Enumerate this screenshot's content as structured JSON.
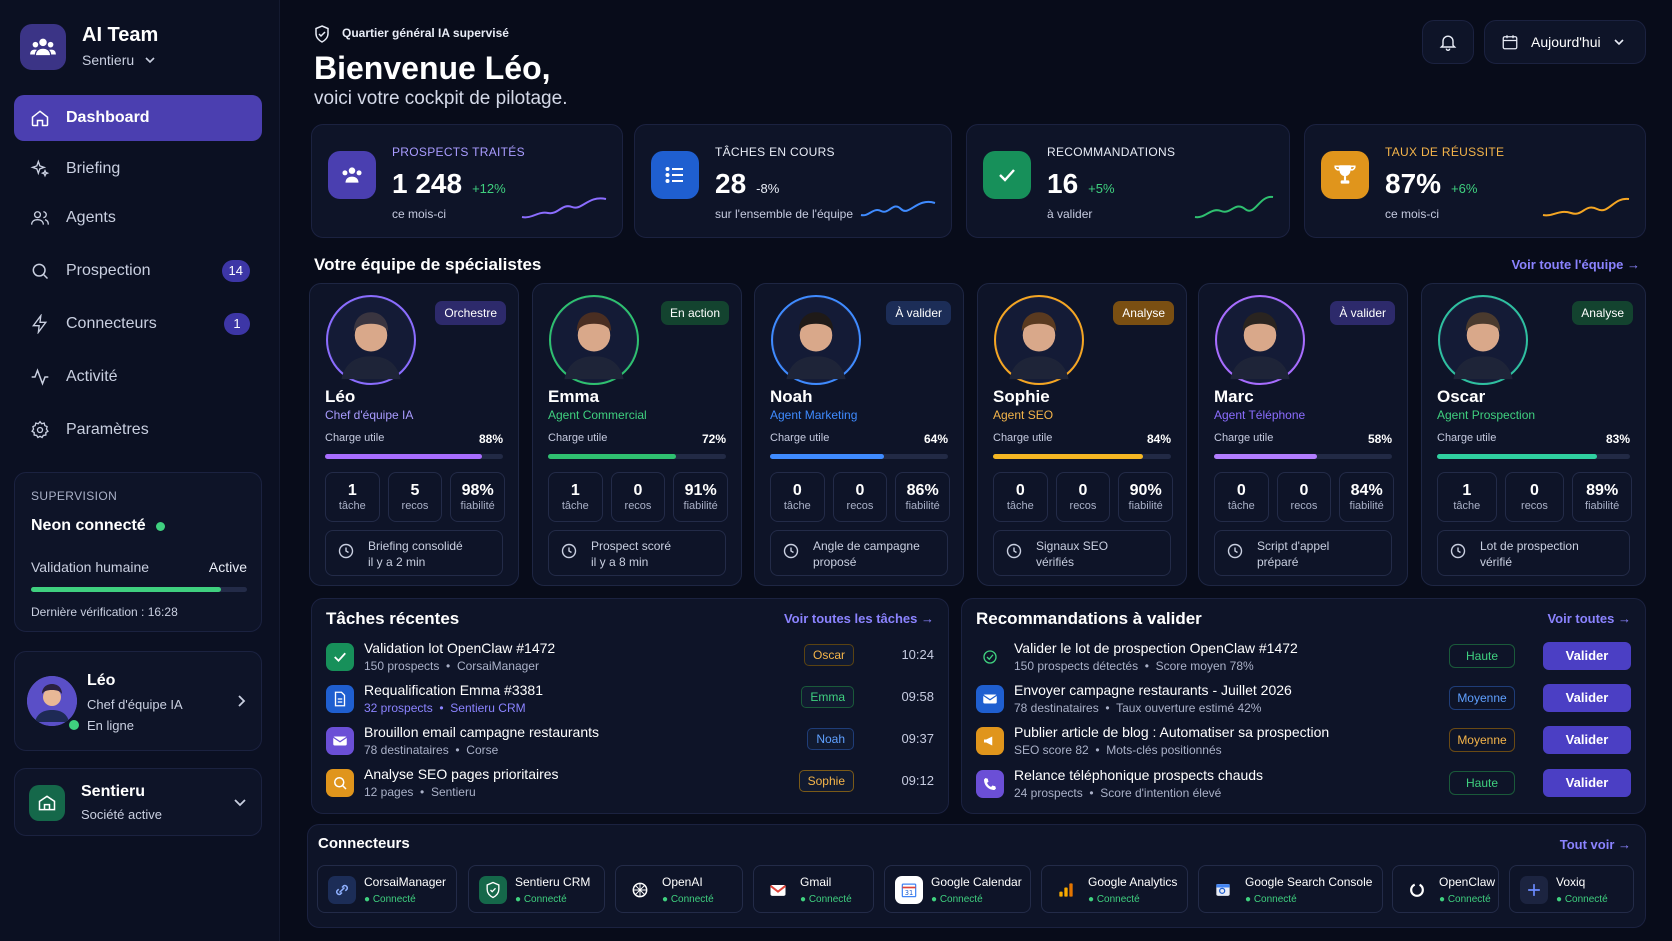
{
  "colors": {
    "accent": "#4b3fb0",
    "success": "#3fd07f",
    "warning": "#f5a623"
  },
  "sidebar": {
    "team_name": "AI Team",
    "org": "Sentieru",
    "nav": [
      {
        "label": "Dashboard",
        "icon": "home-icon"
      },
      {
        "label": "Briefing",
        "icon": "sparkle-icon"
      },
      {
        "label": "Agents",
        "icon": "users-icon"
      },
      {
        "label": "Prospection",
        "icon": "search-icon",
        "badge": "14"
      },
      {
        "label": "Connecteurs",
        "icon": "bolt-icon",
        "badge": "1"
      },
      {
        "label": "Activité",
        "icon": "activity-icon"
      },
      {
        "label": "Paramètres",
        "icon": "gear-icon"
      }
    ],
    "supervision": {
      "title": "SUPERVISION",
      "status": "Neon connecté",
      "validation_label": "Validation humaine",
      "validation_state": "Active",
      "progress": 0.88,
      "last_check": "Dernière vérification : 16:28"
    },
    "user": {
      "name": "Léo",
      "role": "Chef d'équipe IA",
      "status": "En ligne"
    },
    "company": {
      "name": "Sentieru",
      "sub": "Société active"
    }
  },
  "header": {
    "supervised": "Quartier général IA supervisé",
    "title": "Bienvenue Léo,",
    "subtitle": "voici votre cockpit de pilotage.",
    "date_button": "Aujourd'hui"
  },
  "stats": [
    {
      "label": "PROSPECTS TRAITÉS",
      "value": "1 248",
      "change": "+12%",
      "sub": "ce mois-ci"
    },
    {
      "label": "TÂCHES EN COURS",
      "value": "28",
      "change": "-8%",
      "sub": "sur l'ensemble de l'équipe"
    },
    {
      "label": "RECOMMANDATIONS",
      "value": "16",
      "change": "+5%",
      "sub": "à valider"
    },
    {
      "label": "TAUX DE RÉUSSITE",
      "value": "87%",
      "change": "+6%",
      "sub": "ce mois-ci"
    }
  ],
  "team": {
    "title": "Votre équipe de spécialistes",
    "link": "Voir toute l'équipe →",
    "load_label": "Charge utile",
    "tache_label": "tâche",
    "recos_label": "recos",
    "fiab_label": "fiabilité",
    "members": [
      {
        "name": "Léo",
        "role": "Chef d'équipe IA",
        "status": "Orchestre",
        "load": "88%",
        "load_value": 0.88,
        "taches": "1",
        "recos": "5",
        "fiabilite": "98%",
        "activity": "Briefing consolidé",
        "activity_time": "il y a 2 min"
      },
      {
        "name": "Emma",
        "role": "Agent Commercial",
        "status": "En action",
        "load": "72%",
        "load_value": 0.72,
        "taches": "1",
        "recos": "0",
        "fiabilite": "91%",
        "activity": "Prospect scoré",
        "activity_time": "il y a 8 min"
      },
      {
        "name": "Noah",
        "role": "Agent Marketing",
        "status": "À valider",
        "load": "64%",
        "load_value": 0.64,
        "taches": "0",
        "recos": "0",
        "fiabilite": "86%",
        "activity": "Angle de campagne",
        "activity_time": "proposé"
      },
      {
        "name": "Sophie",
        "role": "Agent SEO",
        "status": "Analyse",
        "load": "84%",
        "load_value": 0.84,
        "taches": "0",
        "recos": "0",
        "fiabilite": "90%",
        "activity": "Signaux SEO",
        "activity_time": "vérifiés"
      },
      {
        "name": "Marc",
        "role": "Agent Téléphone",
        "status": "À valider",
        "load": "58%",
        "load_value": 0.58,
        "taches": "0",
        "recos": "0",
        "fiabilite": "84%",
        "activity": "Script d'appel",
        "activity_time": "préparé"
      },
      {
        "name": "Oscar",
        "role": "Agent Prospection",
        "status": "Analyse",
        "load": "83%",
        "load_value": 0.83,
        "taches": "1",
        "recos": "0",
        "fiabilite": "89%",
        "activity": "Lot de prospection",
        "activity_time": "vérifié"
      }
    ]
  },
  "tasks": {
    "title": "Tâches récentes",
    "link": "Voir toutes les tâches →",
    "items": [
      {
        "title": "Validation lot OpenClaw #1472",
        "sub1": "150 prospects",
        "sub2": "CorsaiManager",
        "agent": "Oscar",
        "time": "10:24"
      },
      {
        "title": "Requalification Emma #3381",
        "sub1": "32 prospects",
        "sub2": "Sentieru CRM",
        "agent": "Emma",
        "time": "09:58"
      },
      {
        "title": "Brouillon email campagne restaurants",
        "sub1": "78 destinataires",
        "sub2": "Corse",
        "agent": "Noah",
        "time": "09:37"
      },
      {
        "title": "Analyse SEO pages prioritaires",
        "sub1": "12 pages",
        "sub2": "Sentieru",
        "agent": "Sophie",
        "time": "09:12"
      }
    ]
  },
  "recos": {
    "title": "Recommandations à valider",
    "link": "Voir toutes →",
    "button": "Valider",
    "items": [
      {
        "title": "Valider le lot de prospection OpenClaw #1472",
        "sub1": "150 prospects détectés",
        "sub2": "Score moyen 78%",
        "priority": "Haute"
      },
      {
        "title": "Envoyer campagne restaurants - Juillet 2026",
        "sub1": "78 destinataires",
        "sub2": "Taux ouverture estimé 42%",
        "priority": "Moyenne"
      },
      {
        "title": "Publier article de blog : Automatiser sa prospection",
        "sub1": "SEO score 82",
        "sub2": "Mots-clés positionnés",
        "priority": "Moyenne"
      },
      {
        "title": "Relance téléphonique prospects chauds",
        "sub1": "24 prospects",
        "sub2": "Score d'intention élevé",
        "priority": "Haute"
      }
    ]
  },
  "connectors": {
    "title": "Connecteurs",
    "link": "Tout voir →",
    "status": "Connecté",
    "items": [
      {
        "name": "CorsaiManager",
        "icon": "link-icon"
      },
      {
        "name": "Sentieru CRM",
        "icon": "shield-icon"
      },
      {
        "name": "OpenAI",
        "icon": "openai-icon"
      },
      {
        "name": "Gmail",
        "icon": "gmail-icon"
      },
      {
        "name": "Google Calendar",
        "icon": "calendar-icon"
      },
      {
        "name": "Google Analytics",
        "icon": "analytics-icon"
      },
      {
        "name": "Google Search Console",
        "icon": "search-console-icon"
      },
      {
        "name": "OpenClaw",
        "icon": "openclaw-icon"
      },
      {
        "name": "Voxiq",
        "icon": "voxiq-icon"
      }
    ]
  }
}
